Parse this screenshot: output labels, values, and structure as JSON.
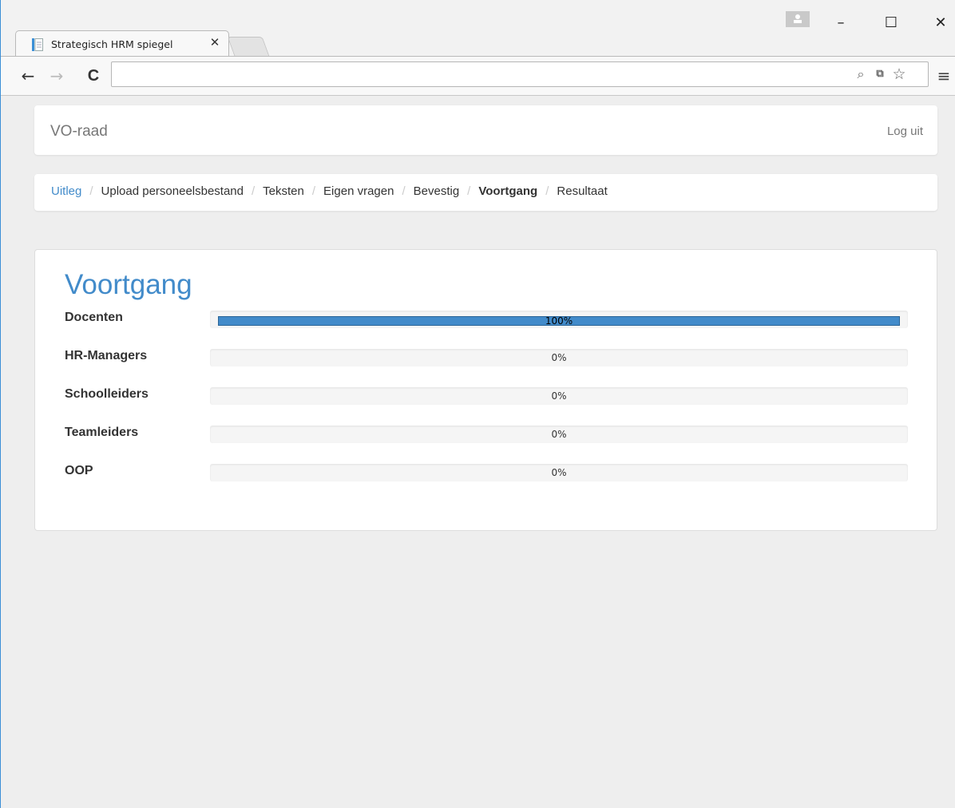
{
  "browser": {
    "tab_title": "Strategisch HRM spiegel",
    "tab_close": "✕",
    "back": "←",
    "forward": "→",
    "reload": "C",
    "address": "",
    "icons": [
      "zoom-icon",
      "translate-icon",
      "star-icon",
      "menu-icon"
    ],
    "window_controls": [
      "minimize",
      "maximize",
      "close"
    ]
  },
  "navbar": {
    "brand": "VO-raad",
    "logout": "Log uit"
  },
  "breadcrumb": {
    "separator": "/",
    "items": [
      {
        "label": "Uitleg",
        "state": "link"
      },
      {
        "label": "Upload personeelsbestand",
        "state": "default"
      },
      {
        "label": "Teksten",
        "state": "default"
      },
      {
        "label": "Eigen vragen",
        "state": "default"
      },
      {
        "label": "Bevestig",
        "state": "default"
      },
      {
        "label": "Voortgang",
        "state": "active"
      },
      {
        "label": "Resultaat",
        "state": "default"
      }
    ]
  },
  "progress": {
    "title": "Voortgang",
    "rows": [
      {
        "label": "Docenten",
        "percent_text": "100%",
        "value": 1.0
      },
      {
        "label": "HR-Managers",
        "percent_text": "0%",
        "value": 0
      },
      {
        "label": "Schoolleiders",
        "percent_text": "0%",
        "value": 0
      },
      {
        "label": "Teamleiders",
        "percent_text": "0%",
        "value": 0
      },
      {
        "label": "OOP",
        "percent_text": "0%",
        "value": 0
      }
    ]
  },
  "colors": {
    "accent": "#428bca",
    "page_bg": "#eeeeee",
    "bar_fill": "#428bca"
  }
}
